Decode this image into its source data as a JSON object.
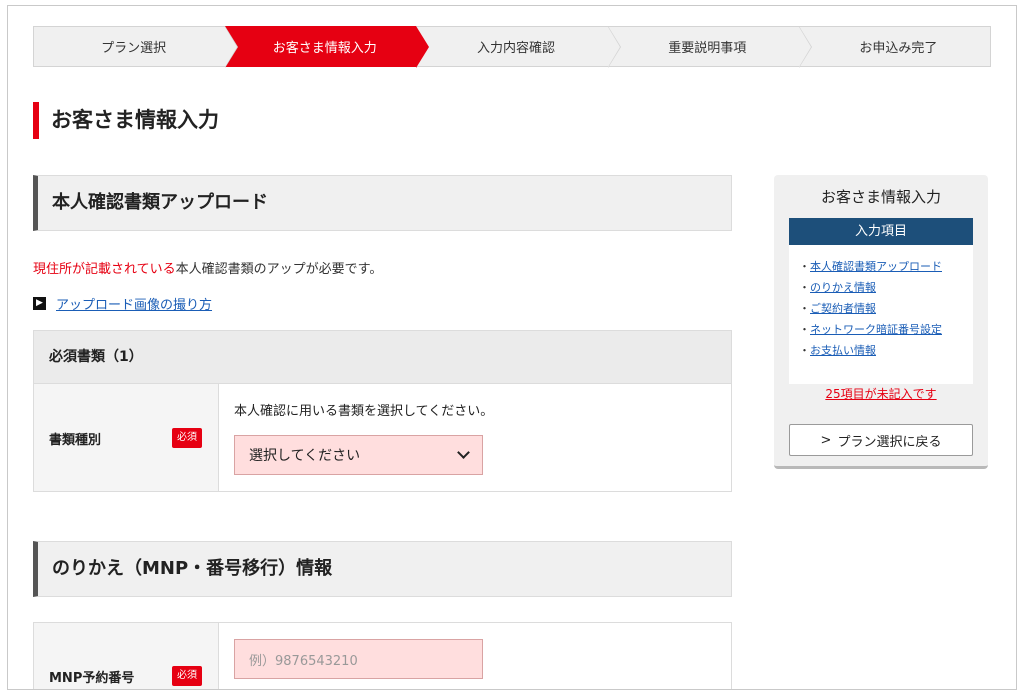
{
  "steps": [
    {
      "label": "プラン選択",
      "active": false
    },
    {
      "label": "お客さま情報入力",
      "active": true
    },
    {
      "label": "入力内容確認",
      "active": false
    },
    {
      "label": "重要説明事項",
      "active": false
    },
    {
      "label": "お申込み完了",
      "active": false
    }
  ],
  "page_title": "お客さま情報入力",
  "section1": {
    "title": "本人確認書類アップロード",
    "notice_red": "現住所が記載されている",
    "notice_rest": "本人確認書類のアップが必要です。",
    "howto_link": "アップロード画像の撮り方",
    "box_caption": "必須書類（1）",
    "doc_type_label": "書類種別",
    "required_badge": "必須",
    "doc_type_help": "本人確認に用いる書類を選択してください。",
    "doc_type_select": "選択してください"
  },
  "section2": {
    "title": "のりかえ（MNP・番号移行）情報",
    "mnp_label": "MNP予約番号",
    "required_badge": "必須",
    "mnp_placeholder": "例）9876543210"
  },
  "sidebar": {
    "title": "お客さま情報入力",
    "list_header": "入力項目",
    "items": [
      "本人確認書類アップロード",
      "のりかえ情報",
      "ご契約者情報",
      "ネットワーク暗証番号設定",
      "お支払い情報"
    ],
    "warning": "25項目が未記入です",
    "back_button": "プラン選択に戻る"
  },
  "colors": {
    "accent": "#e60012",
    "navy": "#1d4f7a",
    "link": "#1a5db6"
  }
}
